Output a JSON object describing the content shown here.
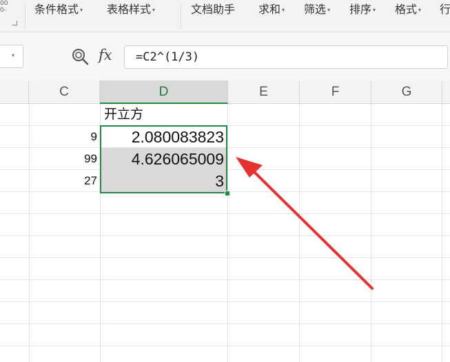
{
  "toolbar": {
    "corner_glyph": "00\n0-",
    "items": [
      {
        "label": "条件格式",
        "caret": "▾"
      },
      {
        "label": "表格样式",
        "caret": "▾"
      },
      {
        "label": "文档助手",
        "caret": ""
      },
      {
        "label": "求和",
        "caret": "▾"
      },
      {
        "label": "筛选",
        "caret": "▾"
      },
      {
        "label": "排序",
        "caret": "▾"
      },
      {
        "label": "格式",
        "caret": "▾"
      },
      {
        "label": "行",
        "caret": ""
      }
    ]
  },
  "formula_bar": {
    "fx_label": "fx",
    "formula": "=C2^(1/3)"
  },
  "columns": [
    "C",
    "D",
    "E",
    "F",
    "G"
  ],
  "cells": {
    "d1": "开立方",
    "c2": "9",
    "d2": "2.080083823",
    "c3": "99",
    "d3": "4.626065009",
    "c4": "27",
    "d4": "3"
  },
  "colors": {
    "selection": "#1e8c45",
    "arrow": "#e8312f",
    "selected_fill": "#d9d9d9"
  }
}
